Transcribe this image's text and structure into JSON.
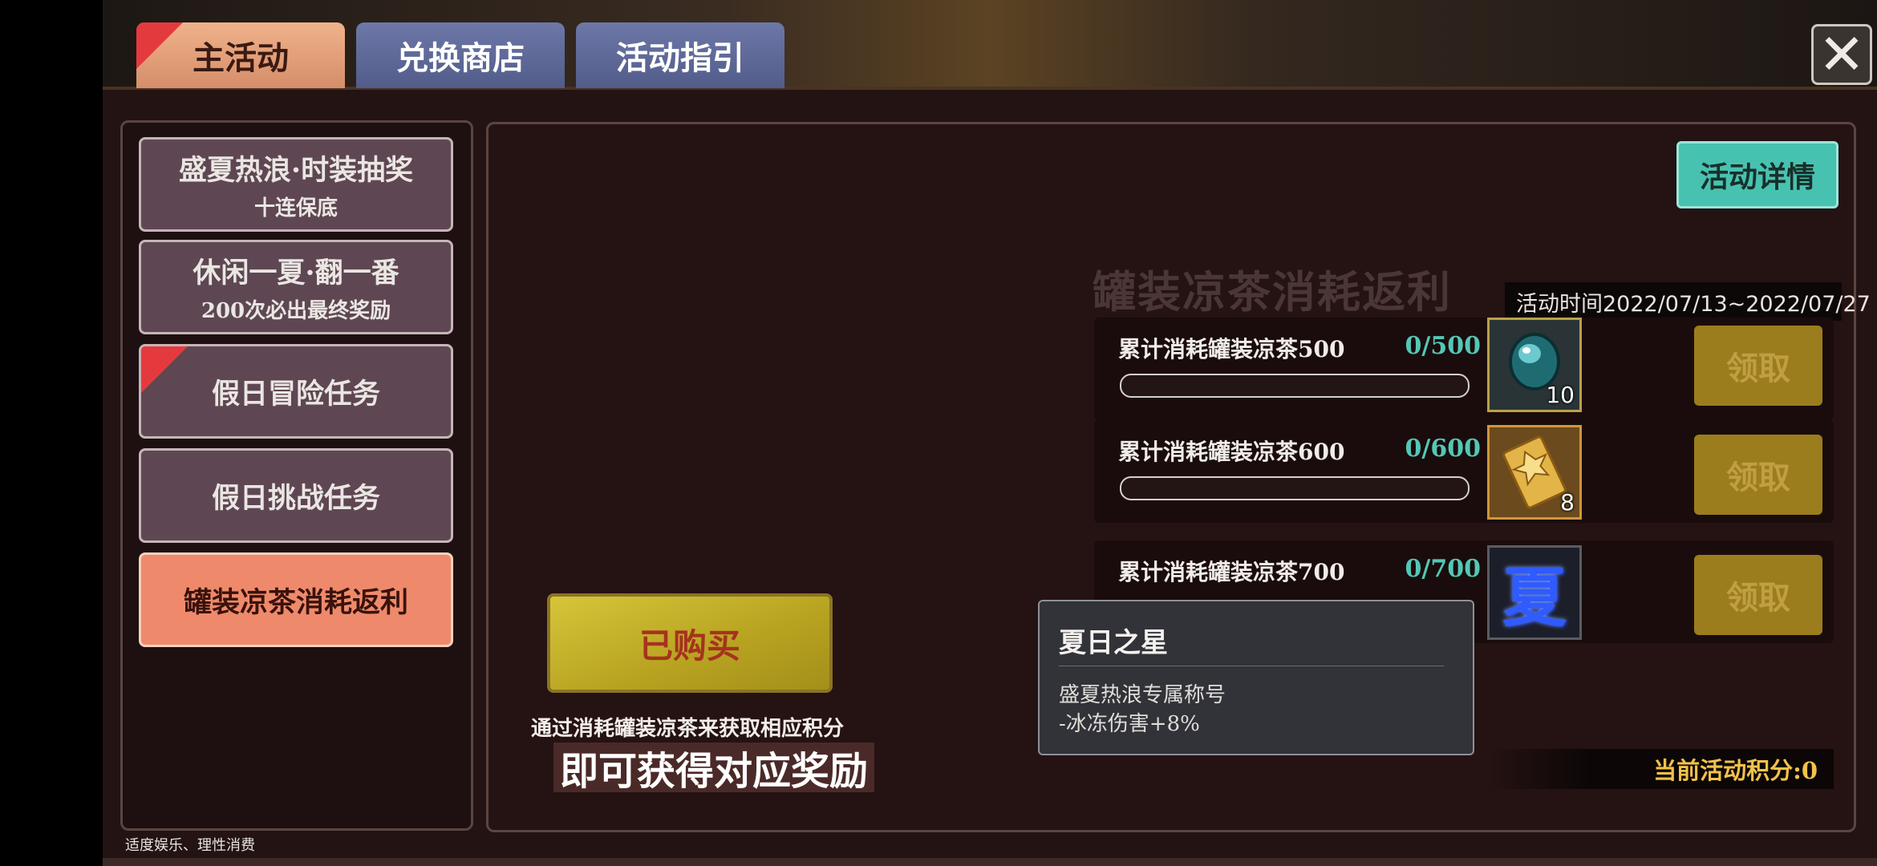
{
  "tabs": [
    {
      "label": "主活动",
      "active": true
    },
    {
      "label": "兑换商店",
      "active": false
    },
    {
      "label": "活动指引",
      "active": false
    }
  ],
  "close": {
    "icon": "close-icon"
  },
  "sidebar": {
    "items": [
      {
        "title": "盛夏热浪·时装抽奖",
        "subtitle": "十连保底"
      },
      {
        "title": "休闲一夏·翻一番",
        "subtitle": "200次必出最终奖励"
      },
      {
        "title": "假日冒险任务",
        "subtitle": ""
      },
      {
        "title": "假日挑战任务",
        "subtitle": ""
      },
      {
        "title": "罐装凉茶消耗返利",
        "subtitle": ""
      }
    ]
  },
  "main": {
    "detail_button": "活动详情",
    "event_title": "罐装凉茶消耗返利",
    "event_time": "活动时间2022/07/13~2022/07/27",
    "tasks": [
      {
        "label": "累计消耗罐装凉茶500",
        "count": "0/500",
        "progress": 0,
        "reward_icon": "gem-icon",
        "reward_qty": "10",
        "claim": "领取"
      },
      {
        "label": "累计消耗罐装凉茶600",
        "count": "0/600",
        "progress": 0,
        "reward_icon": "golden-ticket-icon",
        "reward_qty": "8",
        "claim": "领取"
      },
      {
        "label": "累计消耗罐装凉茶700",
        "count": "0/700",
        "progress": 0,
        "reward_icon": "summer-title-icon",
        "reward_qty": "",
        "reward_glyph": "夏",
        "claim": "领取"
      }
    ],
    "bought_button": "已购买",
    "description_line1": "通过消耗罐装凉茶来获取相应积分",
    "description_line2": "即可获得对应奖励",
    "points": "当前活动积分:0"
  },
  "tooltip": {
    "title": "夏日之星",
    "line1": "盛夏热浪专属称号",
    "line2": "-冰冻伤害+8%"
  },
  "footer_note": "适度娱乐、理性消费",
  "colors": {
    "accent_teal": "#54c7b6",
    "active_item": "#ee8a6b",
    "claim_disabled": "#9b7d1d",
    "points_text": "#f1c24a"
  }
}
